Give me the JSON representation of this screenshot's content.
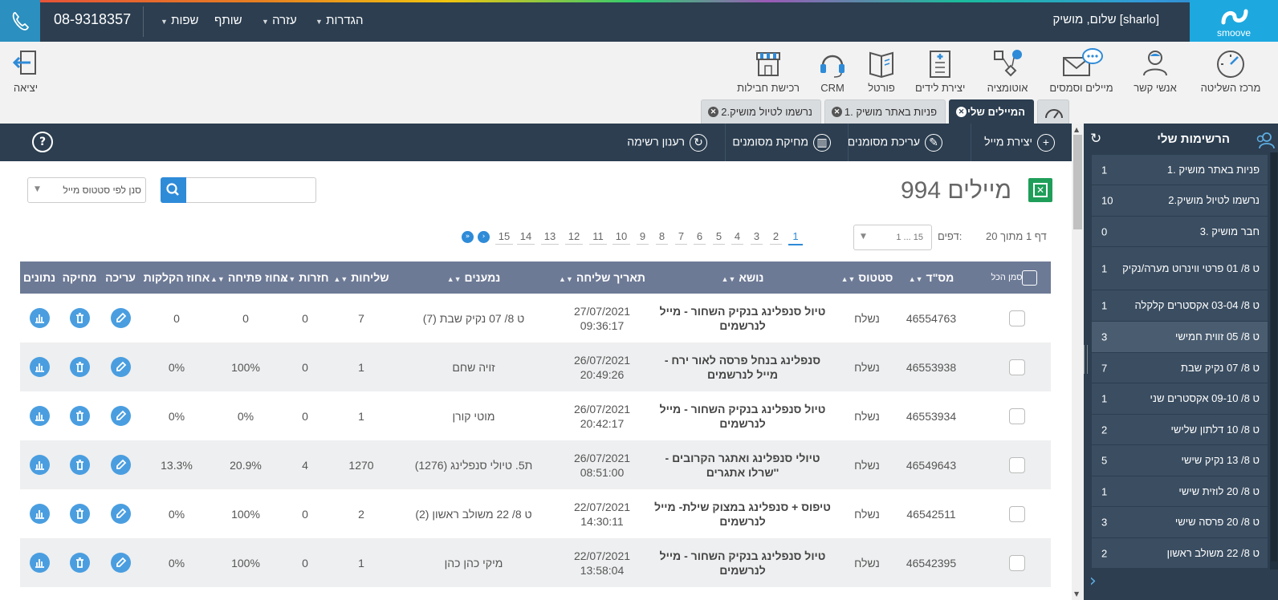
{
  "header": {
    "brand": "smoove",
    "greeting": "שלום, מושיק [sharlo]",
    "phone": "08-9318357",
    "menus": [
      "הגדרות",
      "עזרה",
      "שותף",
      "שפות"
    ]
  },
  "toolbar": {
    "items": [
      "מרכז השליטה",
      "אנשי קשר",
      "מיילים וסמסים",
      "אוטומציה",
      "יצירת לידים",
      "פורטל",
      "CRM",
      "רכישת חבילות"
    ],
    "logout": "יציאה"
  },
  "tabs": [
    "המיילים שלי",
    "1. פניות באתר מושיק",
    "2.נרשמו לטיול מושיק"
  ],
  "actions": {
    "create": "יצירת מייל",
    "edit": "עריכת מסומנים",
    "delete": "מחיקת מסומנים",
    "refresh": "רענון רשימה"
  },
  "main": {
    "count_title": "994 מיילים",
    "search_placeholder": "",
    "status_filter": "סנן לפי סטטוס מייל"
  },
  "pagination": {
    "info": "דף 1 מתוך 20",
    "pages_label": "דפים:",
    "select_value": "1 ... 15",
    "pages": [
      "1",
      "2",
      "3",
      "4",
      "5",
      "6",
      "7",
      "8",
      "9",
      "10",
      "11",
      "12",
      "13",
      "14",
      "15"
    ],
    "current": "1"
  },
  "table": {
    "headers": {
      "select_all": "סמן הכל",
      "id": "מס\"ד",
      "status": "סטטוס",
      "subject": "נושא",
      "sent_date": "תאריך שליחה",
      "recipients": "נמענים",
      "sends": "שליחות",
      "bounces": "חזרות",
      "open_rate": "אחוז פתיחה",
      "click_rate": "אחוז הקלקות",
      "edit": "עריכה",
      "delete": "מחיקה",
      "stats": "נתונים"
    },
    "rows": [
      {
        "id": "46554763",
        "status": "נשלח",
        "subject": "טיול סנפלינג בנקיק השחור - מייל לנרשמים",
        "date": "27/07/2021",
        "time": "09:36:17",
        "recipients": "ט 8/ 07 נקיק שבת (7)",
        "sends": "7",
        "bounces": "0",
        "open": "0",
        "click": "0"
      },
      {
        "id": "46553938",
        "status": "נשלח",
        "subject": "סנפלינג בנחל פרסה לאור ירח - מייל לנרשמים",
        "date": "26/07/2021",
        "time": "20:49:26",
        "recipients": "זויה שחם",
        "sends": "1",
        "bounces": "0",
        "open": "100%",
        "click": "0%"
      },
      {
        "id": "46553934",
        "status": "נשלח",
        "subject": "טיול סנפלינג בנקיק השחור - מייל לנרשמים",
        "date": "26/07/2021",
        "time": "20:42:17",
        "recipients": "מוטי קורן",
        "sends": "1",
        "bounces": "0",
        "open": "0%",
        "click": "0%"
      },
      {
        "id": "46549643",
        "status": "נשלח",
        "subject": "טיולי סנפלינג ואתגר הקרובים - 'שרלו אתגרים'",
        "date": "26/07/2021",
        "time": "08:51:00",
        "recipients": "ת5. טיולי סנפלינג (1276)",
        "sends": "1270",
        "bounces": "4",
        "open": "20.9%",
        "click": "13.3%"
      },
      {
        "id": "46542511",
        "status": "נשלח",
        "subject": "טיפוס + סנפלינג במצוק שילת- מייל לנרשמים",
        "date": "22/07/2021",
        "time": "14:30:11",
        "recipients": "ט 8/ 22 משולב ראשון (2)",
        "sends": "2",
        "bounces": "0",
        "open": "100%",
        "click": "0%"
      },
      {
        "id": "46542395",
        "status": "נשלח",
        "subject": "טיול סנפלינג בנקיק השחור - מייל לנרשמים",
        "date": "22/07/2021",
        "time": "13:58:04",
        "recipients": "מיקי כהן כהן",
        "sends": "1",
        "bounces": "0",
        "open": "100%",
        "click": "0%"
      }
    ]
  },
  "sidebar": {
    "title": "הרשימות שלי",
    "items": [
      {
        "label": "1. פניות באתר מושיק",
        "count": "1"
      },
      {
        "label": "2.נרשמו לטיול מושיק",
        "count": "10"
      },
      {
        "label": "3. חבר מושיק",
        "count": "0"
      },
      {
        "label": "ט 8/ 01 פרטי ווינרוט מערה/נקיק",
        "count": "1"
      },
      {
        "label": "ט 8/ 03-04 אקסטרים קלקלה",
        "count": "1"
      },
      {
        "label": "ט 8/ 05 זווית חמישי",
        "count": "3"
      },
      {
        "label": "ט 8/ 07 נקיק שבת",
        "count": "7"
      },
      {
        "label": "ט 8/ 09-10 אקסטרים שני",
        "count": "1"
      },
      {
        "label": "ט 8/ 10 דלתון שלישי",
        "count": "2"
      },
      {
        "label": "ט 8/ 13 נקיק שישי",
        "count": "5"
      },
      {
        "label": "ט 8/ 20 לוזית שישי",
        "count": "1"
      },
      {
        "label": "ט 8/ 20 פרסה שישי",
        "count": "3"
      },
      {
        "label": "ט 8/ 22 משולב ראשון",
        "count": "2"
      }
    ]
  },
  "colors": {
    "header_bg": "#2c3e50",
    "brand": "#1da9e0",
    "accent": "#2e8bd8",
    "table_header": "#6d7a96",
    "excel": "#1f9e5a"
  }
}
